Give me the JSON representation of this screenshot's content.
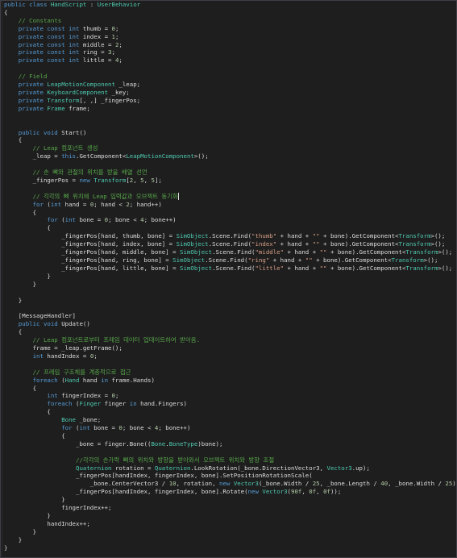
{
  "colors": {
    "background": "#1e1e1e",
    "keyword": "#569cd6",
    "type": "#4ec9b0",
    "string": "#d69d85",
    "comment": "#57a64a",
    "number": "#b5cea8",
    "text": "#dcdcdc"
  },
  "lines": [
    [
      [
        "kw",
        "public class "
      ],
      [
        "ty",
        "HandScript"
      ],
      [
        "tx",
        " : "
      ],
      [
        "ty",
        "UserBehavior"
      ]
    ],
    [
      [
        "tx",
        "{"
      ]
    ],
    [
      [
        "cm",
        "    // Constants"
      ]
    ],
    [
      [
        "kw",
        "    private const int "
      ],
      [
        "tx",
        "thumb = "
      ],
      [
        "nm",
        "0"
      ],
      [
        "tx",
        ";"
      ]
    ],
    [
      [
        "kw",
        "    private const int "
      ],
      [
        "tx",
        "index = "
      ],
      [
        "nm",
        "1"
      ],
      [
        "tx",
        ";"
      ]
    ],
    [
      [
        "kw",
        "    private const int "
      ],
      [
        "tx",
        "middle = "
      ],
      [
        "nm",
        "2"
      ],
      [
        "tx",
        ";"
      ]
    ],
    [
      [
        "kw",
        "    private const int "
      ],
      [
        "tx",
        "ring = "
      ],
      [
        "nm",
        "3"
      ],
      [
        "tx",
        ";"
      ]
    ],
    [
      [
        "kw",
        "    private const int "
      ],
      [
        "tx",
        "little = "
      ],
      [
        "nm",
        "4"
      ],
      [
        "tx",
        ";"
      ]
    ],
    [
      [
        "tx",
        ""
      ]
    ],
    [
      [
        "cm",
        "    // Field"
      ]
    ],
    [
      [
        "kw",
        "    private "
      ],
      [
        "ty",
        "LeapMotionComponent"
      ],
      [
        "tx",
        " _leap;"
      ]
    ],
    [
      [
        "kw",
        "    private "
      ],
      [
        "ty",
        "KeyboardComponent"
      ],
      [
        "tx",
        " _key;"
      ]
    ],
    [
      [
        "kw",
        "    private "
      ],
      [
        "ty",
        "Transform"
      ],
      [
        "tx",
        "[, ,] _fingerPos;"
      ]
    ],
    [
      [
        "kw",
        "    private "
      ],
      [
        "ty",
        "Frame"
      ],
      [
        "tx",
        " frame;"
      ]
    ],
    [
      [
        "tx",
        ""
      ]
    ],
    [
      [
        "tx",
        ""
      ]
    ],
    [
      [
        "kw",
        "    public void "
      ],
      [
        "tx",
        "Start()"
      ]
    ],
    [
      [
        "tx",
        "    {"
      ]
    ],
    [
      [
        "cm",
        "        // Leap 컴포넌트 생성"
      ]
    ],
    [
      [
        "tx",
        "        _leap = "
      ],
      [
        "kw",
        "this"
      ],
      [
        "tx",
        ".GetComponent<"
      ],
      [
        "ty",
        "LeapMotionComponent"
      ],
      [
        "tx",
        ">();"
      ]
    ],
    [
      [
        "tx",
        ""
      ]
    ],
    [
      [
        "cm",
        "        // 손 뼈와 관절의 위치를 받을 배열 선언"
      ]
    ],
    [
      [
        "tx",
        "        _fingerPos = "
      ],
      [
        "kw",
        "new "
      ],
      [
        "ty",
        "Transform"
      ],
      [
        "tx",
        "["
      ],
      [
        "nm",
        "2"
      ],
      [
        "tx",
        ", "
      ],
      [
        "nm",
        "5"
      ],
      [
        "tx",
        ", "
      ],
      [
        "nm",
        "5"
      ],
      [
        "tx",
        "];"
      ]
    ],
    [
      [
        "tx",
        ""
      ]
    ],
    [
      [
        "cm",
        "        // 각각의 뼈 위치에 Leap 입력값과 오브젝트 동기화"
      ],
      [
        "caret",
        ""
      ]
    ],
    [
      [
        "kw",
        "        for "
      ],
      [
        "tx",
        "("
      ],
      [
        "kw",
        "int "
      ],
      [
        "tx",
        "hand = "
      ],
      [
        "nm",
        "0"
      ],
      [
        "tx",
        "; hand < "
      ],
      [
        "nm",
        "2"
      ],
      [
        "tx",
        "; hand++)"
      ]
    ],
    [
      [
        "tx",
        "        {"
      ]
    ],
    [
      [
        "kw",
        "            for "
      ],
      [
        "tx",
        "("
      ],
      [
        "kw",
        "int "
      ],
      [
        "tx",
        "bone = "
      ],
      [
        "nm",
        "0"
      ],
      [
        "tx",
        "; bone < "
      ],
      [
        "nm",
        "4"
      ],
      [
        "tx",
        "; bone++)"
      ]
    ],
    [
      [
        "tx",
        "            {"
      ]
    ],
    [
      [
        "tx",
        "                _fingerPos[hand, thumb, bone] = "
      ],
      [
        "ty",
        "SimObject"
      ],
      [
        "tx",
        ".Scene.Find("
      ],
      [
        "st",
        "\"thumb\""
      ],
      [
        "tx",
        " + hand + "
      ],
      [
        "st",
        "\"\""
      ],
      [
        "tx",
        " + bone).GetComponent<"
      ],
      [
        "ty",
        "Transform"
      ],
      [
        "tx",
        ">();"
      ]
    ],
    [
      [
        "tx",
        "                _fingerPos[hand, index, bone] = "
      ],
      [
        "ty",
        "SimObject"
      ],
      [
        "tx",
        ".Scene.Find("
      ],
      [
        "st",
        "\"index\""
      ],
      [
        "tx",
        " + hand + "
      ],
      [
        "st",
        "\"\""
      ],
      [
        "tx",
        " + bone).GetComponent<"
      ],
      [
        "ty",
        "Transform"
      ],
      [
        "tx",
        ">();"
      ]
    ],
    [
      [
        "tx",
        "                _fingerPos[hand, middle, bone] = "
      ],
      [
        "ty",
        "SimObject"
      ],
      [
        "tx",
        ".Scene.Find("
      ],
      [
        "st",
        "\"middle\""
      ],
      [
        "tx",
        " + hand + "
      ],
      [
        "st",
        "\"\""
      ],
      [
        "tx",
        " + bone).GetComponent<"
      ],
      [
        "ty",
        "Transform"
      ],
      [
        "tx",
        ">();"
      ]
    ],
    [
      [
        "tx",
        "                _fingerPos[hand, ring, bone] = "
      ],
      [
        "ty",
        "SimObject"
      ],
      [
        "tx",
        ".Scene.Find("
      ],
      [
        "st",
        "\"ring\""
      ],
      [
        "tx",
        " + hand + "
      ],
      [
        "st",
        "\"\""
      ],
      [
        "tx",
        " + bone).GetComponent<"
      ],
      [
        "ty",
        "Transform"
      ],
      [
        "tx",
        ">();"
      ]
    ],
    [
      [
        "tx",
        "                _fingerPos[hand, little, bone] = "
      ],
      [
        "ty",
        "SimObject"
      ],
      [
        "tx",
        ".Scene.Find("
      ],
      [
        "st",
        "\"little\""
      ],
      [
        "tx",
        " + hand + "
      ],
      [
        "st",
        "\"\""
      ],
      [
        "tx",
        " + bone).GetComponent<"
      ],
      [
        "ty",
        "Transform"
      ],
      [
        "tx",
        ">();"
      ]
    ],
    [
      [
        "tx",
        "            }"
      ]
    ],
    [
      [
        "tx",
        "        }"
      ]
    ],
    [
      [
        "tx",
        ""
      ]
    ],
    [
      [
        "tx",
        "    }"
      ]
    ],
    [
      [
        "tx",
        ""
      ]
    ],
    [
      [
        "tx",
        "    [MessageHandler]"
      ]
    ],
    [
      [
        "kw",
        "    public void "
      ],
      [
        "tx",
        "Update()"
      ]
    ],
    [
      [
        "tx",
        "    {"
      ]
    ],
    [
      [
        "cm",
        "        // Leap 컴포넌트로부터 프레임 데이터 업데이트하여 받아옴."
      ]
    ],
    [
      [
        "tx",
        "        frame = _leap.getFrame();"
      ]
    ],
    [
      [
        "kw",
        "        int "
      ],
      [
        "tx",
        "handIndex = "
      ],
      [
        "nm",
        "0"
      ],
      [
        "tx",
        ";"
      ]
    ],
    [
      [
        "tx",
        ""
      ]
    ],
    [
      [
        "cm",
        "        // 프레임 구조체를 계층적으로 접근"
      ]
    ],
    [
      [
        "kw",
        "        foreach "
      ],
      [
        "tx",
        "("
      ],
      [
        "ty",
        "Hand"
      ],
      [
        "tx",
        " hand "
      ],
      [
        "kw",
        "in "
      ],
      [
        "tx",
        "frame.Hands)"
      ]
    ],
    [
      [
        "tx",
        "        {"
      ]
    ],
    [
      [
        "kw",
        "            int "
      ],
      [
        "tx",
        "fingerIndex = "
      ],
      [
        "nm",
        "0"
      ],
      [
        "tx",
        ";"
      ]
    ],
    [
      [
        "kw",
        "            foreach "
      ],
      [
        "tx",
        "("
      ],
      [
        "ty",
        "Finger"
      ],
      [
        "tx",
        " finger "
      ],
      [
        "kw",
        "in "
      ],
      [
        "tx",
        "hand.Fingers)"
      ]
    ],
    [
      [
        "tx",
        "            {"
      ]
    ],
    [
      [
        "ty",
        "                Bone"
      ],
      [
        "tx",
        " _bone;"
      ]
    ],
    [
      [
        "kw",
        "                for "
      ],
      [
        "tx",
        "("
      ],
      [
        "kw",
        "int "
      ],
      [
        "tx",
        "bone = "
      ],
      [
        "nm",
        "0"
      ],
      [
        "tx",
        "; bone < "
      ],
      [
        "nm",
        "4"
      ],
      [
        "tx",
        "; bone++)"
      ]
    ],
    [
      [
        "tx",
        "                {"
      ]
    ],
    [
      [
        "tx",
        "                    _bone = finger.Bone(("
      ],
      [
        "ty",
        "Bone"
      ],
      [
        "tx",
        "."
      ],
      [
        "ty",
        "BoneType"
      ],
      [
        "tx",
        ")bone);"
      ]
    ],
    [
      [
        "tx",
        ""
      ]
    ],
    [
      [
        "cm",
        "                    //각각의 손가락 뼈의 위치와 방향을 받아와서 오브젝트 위치와 방향 조절"
      ]
    ],
    [
      [
        "ty",
        "                    Quaternion"
      ],
      [
        "tx",
        " rotation = "
      ],
      [
        "ty",
        "Quaternion"
      ],
      [
        "tx",
        ".LookRotation(_bone.DirectionVector3, "
      ],
      [
        "ty",
        "Vector3"
      ],
      [
        "tx",
        ".up);"
      ]
    ],
    [
      [
        "tx",
        "                    _fingerPos[handIndex, fingerIndex, bone].SetPositionRotationScale("
      ]
    ],
    [
      [
        "tx",
        "                        _bone.CenterVector3 / "
      ],
      [
        "nm",
        "10"
      ],
      [
        "tx",
        ", rotation, "
      ],
      [
        "kw",
        "new "
      ],
      [
        "ty",
        "Vector3"
      ],
      [
        "tx",
        "(_bone.Width / "
      ],
      [
        "nm",
        "25"
      ],
      [
        "tx",
        ", _bone.Length / "
      ],
      [
        "nm",
        "40"
      ],
      [
        "tx",
        ", _bone.Width / "
      ],
      [
        "nm",
        "25"
      ],
      [
        "tx",
        "));"
      ]
    ],
    [
      [
        "tx",
        "                    _fingerPos[handIndex, fingerIndex, bone].Rotate("
      ],
      [
        "kw",
        "new "
      ],
      [
        "ty",
        "Vector3"
      ],
      [
        "tx",
        "("
      ],
      [
        "nm",
        "90f"
      ],
      [
        "tx",
        ", "
      ],
      [
        "nm",
        "0f"
      ],
      [
        "tx",
        ", "
      ],
      [
        "nm",
        "0f"
      ],
      [
        "tx",
        "));"
      ]
    ],
    [
      [
        "tx",
        "                }"
      ]
    ],
    [
      [
        "tx",
        "                fingerIndex++;"
      ]
    ],
    [
      [
        "tx",
        "            }"
      ]
    ],
    [
      [
        "tx",
        "            handIndex++;"
      ]
    ],
    [
      [
        "tx",
        "        }"
      ]
    ],
    [
      [
        "tx",
        "    }"
      ]
    ],
    [
      [
        "tx",
        "}"
      ]
    ]
  ]
}
